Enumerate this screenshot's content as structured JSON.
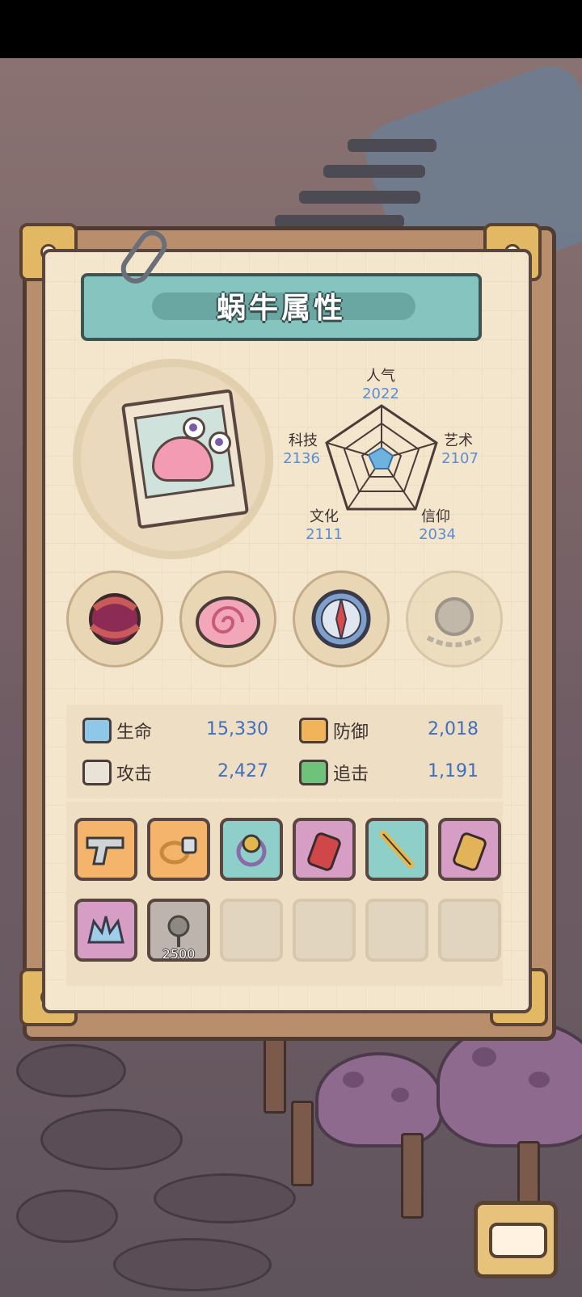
{
  "title": "蜗牛属性",
  "radar": {
    "stats": [
      {
        "label": "人气",
        "value": "2022"
      },
      {
        "label": "艺术",
        "value": "2107"
      },
      {
        "label": "信仰",
        "value": "2034"
      },
      {
        "label": "文化",
        "value": "2111"
      },
      {
        "label": "科技",
        "value": "2136"
      }
    ]
  },
  "equipment": [
    {
      "name": "thorn-heart-relic",
      "icon": "thorn-heart-icon"
    },
    {
      "name": "spiral-shell",
      "icon": "spiral-shell-icon"
    },
    {
      "name": "compass",
      "icon": "compass-icon"
    },
    {
      "name": "chained-orb-locked",
      "icon": "chained-orb-icon"
    }
  ],
  "stats": {
    "hp": {
      "label": "生命",
      "value": "15,330"
    },
    "def": {
      "label": "防御",
      "value": "2,018"
    },
    "atk": {
      "label": "攻击",
      "value": "2,427"
    },
    "pursuit": {
      "label": "追击",
      "value": "1,191"
    }
  },
  "items": [
    {
      "icon": "pistol-icon",
      "color": "orange"
    },
    {
      "icon": "ring-icon",
      "color": "orange"
    },
    {
      "icon": "flower-ring-icon",
      "color": "teal"
    },
    {
      "icon": "red-tag-icon",
      "color": "pink"
    },
    {
      "icon": "golden-staff-icon",
      "color": "teal"
    },
    {
      "icon": "gold-tag-icon",
      "color": "pink"
    },
    {
      "icon": "crystal-crown-icon",
      "color": "pink"
    },
    {
      "icon": "stone-rose-icon",
      "color": "gray",
      "count": "2500"
    }
  ],
  "colors": {
    "value_blue": "#5a8ed2",
    "stat_blue": "#3e6fc0",
    "banner_teal": "#86c4c0",
    "panel_paper": "#f3e6cd"
  }
}
